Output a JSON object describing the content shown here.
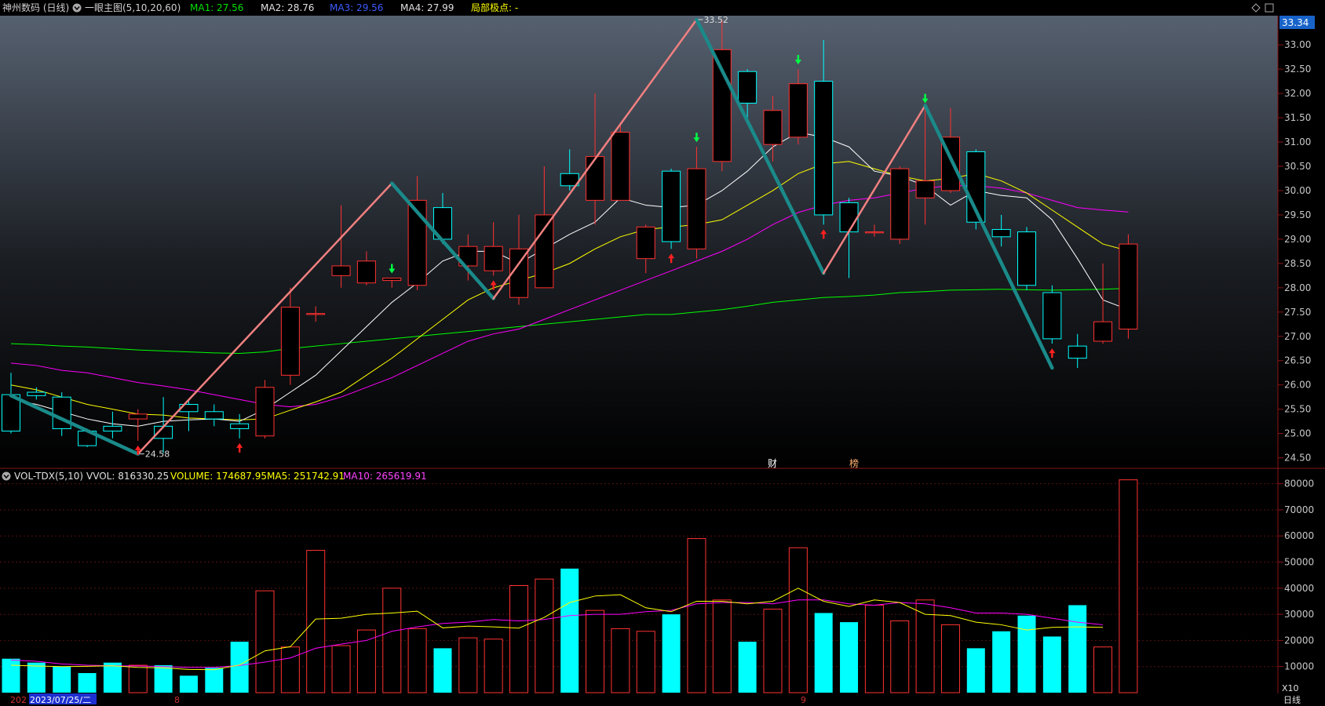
{
  "header": {
    "stock_name": "神州数码 (日线)",
    "indicator_name": "一眼主图(5,10,20,60)",
    "ma1": "MA1: 27.56",
    "ma2": "MA2: 28.76",
    "ma3": "MA3: 29.56",
    "ma4": "MA4: 27.99",
    "pivot": "局部极点: -"
  },
  "vol_header": {
    "name": "VOL-TDX(5,10)",
    "vvol": "VVOL: 816330.25",
    "volume": "VOLUME: 174687.95",
    "ma5": "MA5: 251742.91",
    "ma10": "MA10: 265619.91"
  },
  "markers": {
    "cai": "财",
    "bang": "榜"
  },
  "bottom_bar": {
    "year_fragment": "202",
    "date": "2023/07/25/二",
    "month1": "8",
    "month2": "9",
    "period": "日线",
    "vol_unit": "X10"
  },
  "price_tag": "33.34",
  "colors": {
    "up": "#ff3232",
    "down": "#00ffff",
    "ma5": "#ffffff",
    "ma10": "#ffff00",
    "ma20": "#ff00ff",
    "ma60": "#00ff00",
    "zig_up": "#f08080",
    "zig_down": "#1a8a8a"
  },
  "chart_data": [
    {
      "type": "candlestick",
      "title": "神州数码 (日线)",
      "ylim": [
        24.3,
        33.6
      ],
      "yticks": [
        24.5,
        25.0,
        25.5,
        26.0,
        26.5,
        27.0,
        27.5,
        28.0,
        28.5,
        29.0,
        29.5,
        30.0,
        30.5,
        31.0,
        31.5,
        32.0,
        32.5,
        33.0
      ],
      "candles": [
        {
          "o": 25.8,
          "h": 26.25,
          "l": 25.0,
          "c": 25.05
        },
        {
          "o": 25.85,
          "h": 25.95,
          "l": 25.7,
          "c": 25.78
        },
        {
          "o": 25.75,
          "h": 25.85,
          "l": 24.95,
          "c": 25.1
        },
        {
          "o": 25.05,
          "h": 25.1,
          "l": 24.72,
          "c": 24.75
        },
        {
          "o": 25.15,
          "h": 25.45,
          "l": 24.9,
          "c": 25.05
        },
        {
          "o": 25.3,
          "h": 25.5,
          "l": 24.85,
          "c": 25.4
        },
        {
          "o": 25.15,
          "h": 25.75,
          "l": 24.6,
          "c": 24.9
        },
        {
          "o": 25.6,
          "h": 25.7,
          "l": 25.05,
          "c": 25.45
        },
        {
          "o": 25.45,
          "h": 25.6,
          "l": 25.15,
          "c": 25.3
        },
        {
          "o": 25.2,
          "h": 25.4,
          "l": 24.9,
          "c": 25.1
        },
        {
          "o": 24.95,
          "h": 26.1,
          "l": 24.9,
          "c": 25.95
        },
        {
          "o": 26.2,
          "h": 28.0,
          "l": 26.0,
          "c": 27.6
        },
        {
          "o": 27.45,
          "h": 27.62,
          "l": 27.3,
          "c": 27.47
        },
        {
          "o": 28.25,
          "h": 29.7,
          "l": 28.0,
          "c": 28.45
        },
        {
          "o": 28.1,
          "h": 28.75,
          "l": 28.05,
          "c": 28.55
        },
        {
          "o": 28.15,
          "h": 28.2,
          "l": 28.0,
          "c": 28.2
        },
        {
          "o": 28.05,
          "h": 30.3,
          "l": 27.95,
          "c": 29.8
        },
        {
          "o": 29.65,
          "h": 29.95,
          "l": 28.9,
          "c": 29.0
        },
        {
          "o": 28.45,
          "h": 29.1,
          "l": 28.15,
          "c": 28.85
        },
        {
          "o": 28.35,
          "h": 29.35,
          "l": 28.25,
          "c": 28.85
        },
        {
          "o": 27.8,
          "h": 29.5,
          "l": 27.65,
          "c": 28.8
        },
        {
          "o": 28.0,
          "h": 30.5,
          "l": 28.0,
          "c": 29.5
        },
        {
          "o": 30.35,
          "h": 30.85,
          "l": 30.0,
          "c": 30.1
        },
        {
          "o": 29.8,
          "h": 32.0,
          "l": 29.3,
          "c": 30.7
        },
        {
          "o": 29.8,
          "h": 31.4,
          "l": 29.8,
          "c": 31.2
        },
        {
          "o": 28.6,
          "h": 29.3,
          "l": 28.3,
          "c": 29.25
        },
        {
          "o": 30.4,
          "h": 30.45,
          "l": 28.8,
          "c": 28.95
        },
        {
          "o": 28.8,
          "h": 30.9,
          "l": 28.6,
          "c": 30.45
        },
        {
          "o": 30.6,
          "h": 33.52,
          "l": 30.4,
          "c": 32.9
        },
        {
          "o": 32.45,
          "h": 32.5,
          "l": 31.4,
          "c": 31.8
        },
        {
          "o": 30.95,
          "h": 31.95,
          "l": 30.6,
          "c": 31.65
        },
        {
          "o": 31.1,
          "h": 32.5,
          "l": 30.95,
          "c": 32.2
        },
        {
          "o": 32.25,
          "h": 33.1,
          "l": 29.3,
          "c": 29.5
        },
        {
          "o": 29.75,
          "h": 29.85,
          "l": 28.2,
          "c": 29.15
        },
        {
          "o": 29.15,
          "h": 29.3,
          "l": 29.05,
          "c": 29.15
        },
        {
          "o": 29.0,
          "h": 30.5,
          "l": 28.9,
          "c": 30.45
        },
        {
          "o": 29.85,
          "h": 31.7,
          "l": 29.3,
          "c": 30.2
        },
        {
          "o": 30.0,
          "h": 31.7,
          "l": 29.95,
          "c": 31.1
        },
        {
          "o": 30.8,
          "h": 30.85,
          "l": 29.2,
          "c": 29.35
        },
        {
          "o": 29.2,
          "h": 29.5,
          "l": 28.85,
          "c": 29.05
        },
        {
          "o": 29.15,
          "h": 29.25,
          "l": 27.95,
          "c": 28.05
        },
        {
          "o": 27.9,
          "h": 28.05,
          "l": 26.85,
          "c": 26.95
        },
        {
          "o": 26.8,
          "h": 27.05,
          "l": 26.35,
          "c": 26.55
        },
        {
          "o": 26.9,
          "h": 28.5,
          "l": 26.85,
          "c": 27.3
        },
        {
          "o": 27.15,
          "h": 29.1,
          "l": 26.95,
          "c": 28.9
        }
      ],
      "ma5": [
        25.7,
        25.6,
        25.45,
        25.3,
        25.2,
        25.15,
        25.25,
        25.28,
        25.3,
        25.25,
        25.5,
        25.85,
        26.2,
        26.7,
        27.2,
        27.7,
        28.1,
        28.55,
        28.75,
        28.75,
        28.5,
        28.8,
        29.1,
        29.35,
        29.85,
        29.7,
        29.65,
        29.7,
        30.0,
        30.4,
        30.9,
        31.2,
        31.1,
        30.9,
        30.4,
        30.3,
        30.1,
        29.7,
        30.0,
        29.9,
        29.85,
        29.4,
        28.6,
        27.75,
        27.55
      ],
      "ma10": [
        26.0,
        25.9,
        25.75,
        25.6,
        25.5,
        25.4,
        25.38,
        25.32,
        25.3,
        25.28,
        25.3,
        25.48,
        25.65,
        25.85,
        26.2,
        26.55,
        26.95,
        27.35,
        27.75,
        28.0,
        28.15,
        28.3,
        28.5,
        28.8,
        29.05,
        29.2,
        29.25,
        29.3,
        29.4,
        29.7,
        30.0,
        30.35,
        30.55,
        30.6,
        30.45,
        30.3,
        30.2,
        30.25,
        30.35,
        30.2,
        29.95,
        29.6,
        29.25,
        28.9,
        28.76
      ],
      "ma20": [
        26.45,
        26.4,
        26.3,
        26.25,
        26.15,
        26.05,
        25.98,
        25.9,
        25.8,
        25.7,
        25.6,
        25.55,
        25.6,
        25.75,
        25.95,
        26.15,
        26.4,
        26.65,
        26.9,
        27.05,
        27.15,
        27.35,
        27.55,
        27.75,
        27.95,
        28.15,
        28.35,
        28.55,
        28.75,
        29.0,
        29.3,
        29.55,
        29.7,
        29.8,
        29.85,
        29.95,
        30.05,
        30.1,
        30.1,
        30.05,
        29.95,
        29.8,
        29.65,
        29.6,
        29.56
      ],
      "ma60": [
        26.85,
        26.83,
        26.8,
        26.78,
        26.75,
        26.72,
        26.7,
        26.68,
        26.66,
        26.65,
        26.68,
        26.75,
        26.8,
        26.85,
        26.9,
        26.95,
        27.0,
        27.05,
        27.1,
        27.15,
        27.2,
        27.25,
        27.3,
        27.35,
        27.4,
        27.45,
        27.45,
        27.5,
        27.55,
        27.62,
        27.7,
        27.75,
        27.8,
        27.82,
        27.85,
        27.9,
        27.92,
        27.95,
        27.96,
        27.97,
        27.96,
        27.95,
        27.96,
        27.97,
        27.99
      ],
      "zigzag": [
        {
          "i": 0,
          "p": 25.78,
          "dir": "down"
        },
        {
          "i": 5,
          "p": 24.58,
          "dir": "up"
        },
        {
          "i": 15,
          "p": 30.15,
          "dir": "down"
        },
        {
          "i": 19,
          "p": 27.78,
          "dir": "up"
        },
        {
          "i": 27,
          "p": 33.52,
          "dir": "down"
        },
        {
          "i": 32,
          "p": 28.3,
          "dir": "up"
        },
        {
          "i": 36,
          "p": 31.75,
          "dir": "down"
        },
        {
          "i": 41,
          "p": 26.35,
          "dir": "down"
        }
      ],
      "annotations": [
        {
          "i": 5,
          "p": 24.58,
          "label": "24.58"
        },
        {
          "i": 27,
          "p": 33.52,
          "label": "33.52"
        }
      ],
      "up_arrows": [
        5,
        9,
        19,
        26,
        32,
        41
      ],
      "down_arrows": [
        15,
        27,
        31,
        36
      ]
    },
    {
      "type": "bar",
      "title": "VOL-TDX(5,10)",
      "ylim": [
        0,
        85000
      ],
      "yticks": [
        10000,
        20000,
        30000,
        40000,
        50000,
        60000,
        70000,
        80000
      ],
      "volumes": [
        13000,
        11500,
        10000,
        7500,
        11500,
        10500,
        10500,
        6500,
        9500,
        19500,
        39000,
        17500,
        54500,
        18000,
        24000,
        40000,
        24500,
        17000,
        21000,
        20500,
        41000,
        43500,
        47500,
        31500,
        24500,
        23500,
        30000,
        59000,
        35500,
        19500,
        32000,
        55500,
        30500,
        27000,
        33500,
        27500,
        35500,
        26000,
        17000,
        23500,
        29500,
        21500,
        33500,
        17500,
        81500
      ],
      "vol_ma5": [
        10500,
        10200,
        10000,
        10100,
        10300,
        9700,
        9500,
        8900,
        8800,
        10600,
        16000,
        17600,
        28200,
        28500,
        30000,
        30500,
        31200,
        24800,
        25500,
        25200,
        24700,
        28800,
        34500,
        37000,
        37500,
        32500,
        31000,
        35000,
        35000,
        34000,
        35000,
        40000,
        35000,
        33000,
        35500,
        34500,
        30000,
        29500,
        27000,
        26000,
        24000,
        25000,
        25200,
        25000
      ],
      "vol_ma10": [
        12500,
        12000,
        11000,
        10500,
        10300,
        10200,
        10000,
        9700,
        9700,
        10400,
        11700,
        13300,
        17000,
        18600,
        20000,
        23500,
        25200,
        26500,
        27000,
        28000,
        27500,
        28000,
        29500,
        30000,
        30000,
        31000,
        31500,
        34000,
        34500,
        34500,
        34000,
        35500,
        35500,
        34000,
        33500,
        34500,
        34000,
        32500,
        30500,
        30500,
        30000,
        28500,
        27000,
        26000
      ]
    }
  ]
}
